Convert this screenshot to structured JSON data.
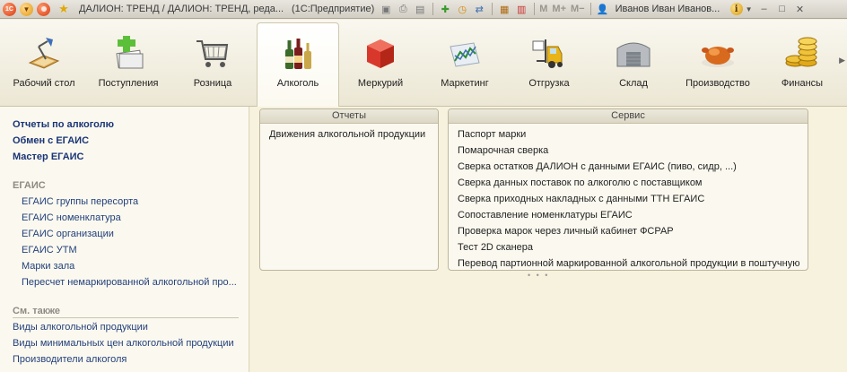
{
  "titlebar": {
    "title": "ДАЛИОН: ТРЕНД / ДАЛИОН: ТРЕНД, реда...",
    "app": "(1С:Предприятие)",
    "logo_text": "1С",
    "m_label": "M",
    "mplus_label": "M+",
    "mminus_label": "M−",
    "user": "Иванов Иван Иванов...",
    "info_label": "i"
  },
  "sections": [
    {
      "label": "Рабочий стол",
      "icon": "desk-lamp-icon"
    },
    {
      "label": "Поступления",
      "icon": "documents-plus-icon"
    },
    {
      "label": "Розница",
      "icon": "shopping-cart-icon"
    },
    {
      "label": "Алкоголь",
      "icon": "bottles-icon"
    },
    {
      "label": "Меркурий",
      "icon": "red-cube-icon"
    },
    {
      "label": "Маркетинг",
      "icon": "chart-icon"
    },
    {
      "label": "Отгрузка",
      "icon": "forklift-icon"
    },
    {
      "label": "Склад",
      "icon": "warehouse-icon"
    },
    {
      "label": "Производство",
      "icon": "roast-chicken-icon"
    },
    {
      "label": "Финансы",
      "icon": "coins-icon"
    }
  ],
  "leftnav": {
    "bold_items": [
      "Отчеты по алкоголю",
      "Обмен с ЕГАИС",
      "Мастер ЕГАИС"
    ],
    "group_egais": "ЕГАИС",
    "egais_items": [
      "ЕГАИС группы пересорта",
      "ЕГАИС номенклатура",
      "ЕГАИС организации",
      "ЕГАИС УТМ",
      "Марки зала",
      "Пересчет немаркированной алкогольной про..."
    ],
    "group_see_also": "См. также",
    "see_also_items": [
      "Виды алкогольной продукции",
      "Виды минимальных цен алкогольной продукции",
      "Производители алкоголя"
    ]
  },
  "reports": {
    "title": "Отчеты",
    "items": [
      "Движения алкогольной продукции"
    ]
  },
  "service": {
    "title": "Сервис",
    "items": [
      "Паспорт марки",
      "Помарочная сверка",
      "Сверка остатков ДАЛИОН с данными ЕГАИС (пиво, сидр, ...)",
      "Сверка данных поставок по алкоголю с поставщиком",
      "Сверка приходных накладных с данными ТТН ЕГАИС",
      "Сопоставление номенклатуры ЕГАИС",
      "Проверка марок через личный кабинет ФСРАР",
      "Тест 2D сканера",
      "Перевод партионной маркированной алкогольной продукции в поштучную"
    ]
  }
}
